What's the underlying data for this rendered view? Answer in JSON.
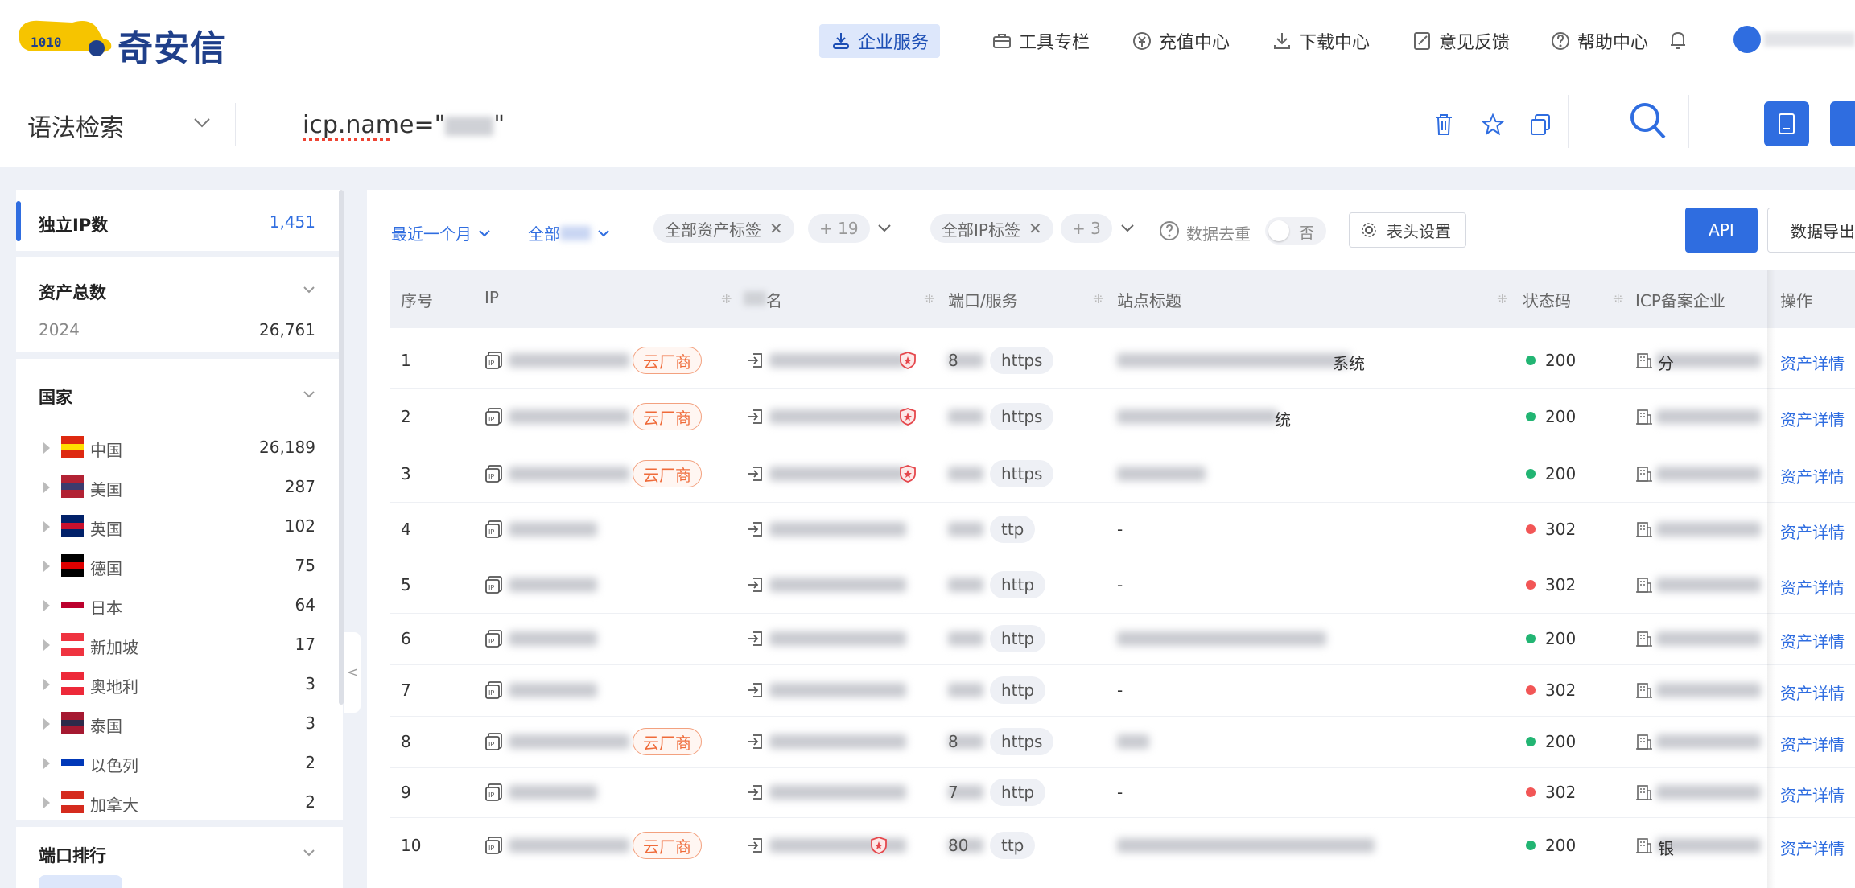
{
  "brand": {
    "name": "奇安信"
  },
  "nav": [
    {
      "label": "企业服务",
      "icon": "enterprise-icon",
      "active": true
    },
    {
      "label": "工具专栏",
      "icon": "toolbox-icon"
    },
    {
      "label": "充值中心",
      "icon": "recharge-icon"
    },
    {
      "label": "下载中心",
      "icon": "download-icon"
    },
    {
      "label": "意见反馈",
      "icon": "feedback-icon"
    },
    {
      "label": "帮助中心",
      "icon": "help-icon"
    }
  ],
  "search": {
    "mode": "语法检索",
    "query_prefix": "icp.name=\"",
    "query_suffix": "\""
  },
  "sidebar": {
    "unique_ip": {
      "label": "独立IP数",
      "value": "1,451"
    },
    "total_assets": {
      "label": "资产总数",
      "year": "2024",
      "value": "26,761"
    },
    "country": {
      "label": "国家",
      "items": [
        {
          "name": "中国",
          "count": "26,189"
        },
        {
          "name": "美国",
          "count": "287"
        },
        {
          "name": "英国",
          "count": "102"
        },
        {
          "name": "德国",
          "count": "75"
        },
        {
          "name": "日本",
          "count": "64"
        },
        {
          "name": "新加坡",
          "count": "17"
        },
        {
          "name": "奥地利",
          "count": "3"
        },
        {
          "name": "泰国",
          "count": "3"
        },
        {
          "name": "以色列",
          "count": "2"
        },
        {
          "name": "加拿大",
          "count": "2"
        }
      ]
    },
    "port_rank": {
      "label": "端口排行"
    },
    "collapse_glyph": "<"
  },
  "filters": {
    "time": "最近一个月",
    "scope_prefix": "全部",
    "asset_tag": "全部资产标签",
    "asset_tag_more": "+ 19",
    "ip_tag": "全部IP标签",
    "ip_tag_more": "+ 3",
    "dedup_label": "数据去重",
    "dedup_value": "否",
    "header_settings": "表头设置",
    "api": "API",
    "export": "数据导出"
  },
  "table": {
    "headers": [
      "序号",
      "IP",
      "名",
      "端口/服务",
      "站点标题",
      "状态码",
      "ICP备案企业",
      "操作"
    ],
    "cloud_badge": "云厂商",
    "action": "资产详情",
    "rows": [
      {
        "no": "1",
        "cloud": true,
        "shield": true,
        "port": "8",
        "proto": "https",
        "title": "系统",
        "title_prefix": "",
        "status": "200",
        "icp": "分",
        "action": "资产详情"
      },
      {
        "no": "2",
        "cloud": true,
        "shield": true,
        "port": "",
        "proto": "https",
        "title": "统",
        "title_prefix": "",
        "status": "200",
        "icp": "",
        "action": "资产详情"
      },
      {
        "no": "3",
        "cloud": true,
        "shield": true,
        "port": "",
        "proto": "https",
        "title": "",
        "title_prefix": "",
        "status": "200",
        "icp": "",
        "action": "资产详情"
      },
      {
        "no": "4",
        "cloud": false,
        "shield": false,
        "port": "",
        "proto": "ttp",
        "title": "-",
        "title_prefix": "",
        "status": "302",
        "icp": "",
        "action": "资产详情"
      },
      {
        "no": "5",
        "cloud": false,
        "shield": false,
        "port": "",
        "proto": "http",
        "title": "-",
        "title_prefix": "",
        "status": "302",
        "icp": "",
        "action": "资产详情"
      },
      {
        "no": "6",
        "cloud": false,
        "shield": false,
        "port": "",
        "proto": "http",
        "title": "",
        "title_prefix": "",
        "status": "200",
        "icp": "",
        "action": "资产详情"
      },
      {
        "no": "7",
        "cloud": false,
        "shield": false,
        "port": "",
        "proto": "http",
        "title": "-",
        "title_prefix": "",
        "status": "302",
        "icp": "",
        "action": "资产详情"
      },
      {
        "no": "8",
        "cloud": true,
        "shield": false,
        "port": "8",
        "proto": "https",
        "title": "",
        "title_prefix": "",
        "status": "200",
        "icp": "",
        "action": "资产详情"
      },
      {
        "no": "9",
        "cloud": false,
        "shield": false,
        "port": "7",
        "proto": "http",
        "title": "-",
        "title_prefix": "",
        "status": "302",
        "icp": "",
        "action": "资产详情"
      },
      {
        "no": "10",
        "cloud": true,
        "shield": true,
        "port": "80",
        "proto": "ttp",
        "title": "",
        "title_prefix": "",
        "status": "200",
        "icp": "银",
        "action": "资产详情"
      }
    ]
  },
  "colors": {
    "primary": "#2f6de0",
    "ok": "#22b573",
    "redirect": "#f25656",
    "cloud": "#ef6b3a"
  }
}
